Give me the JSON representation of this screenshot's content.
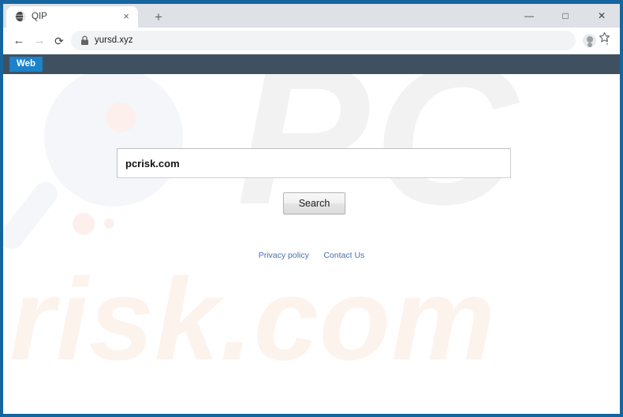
{
  "browser": {
    "tab": {
      "title": "QIP",
      "favicon_icon": "globe-icon",
      "close_icon": "×"
    },
    "new_tab_icon": "+",
    "window_controls": {
      "minimize": "—",
      "maximize": "□",
      "close": "✕"
    },
    "toolbar": {
      "back_icon": "←",
      "forward_icon": "→",
      "reload_icon": "⟳",
      "lock_icon": "lock-icon",
      "url": "yursd.xyz",
      "star_icon": "star-icon",
      "avatar_icon": "profile-avatar-icon",
      "menu_icon": "⋮"
    }
  },
  "site": {
    "nav": {
      "web_tab_label": "Web"
    },
    "search": {
      "value": "pcrisk.com",
      "placeholder": "",
      "button_label": "Search"
    },
    "footer": {
      "links": [
        {
          "label": "Privacy policy"
        },
        {
          "label": "Contact Us"
        }
      ]
    },
    "watermarks": {
      "top_text": "PC",
      "bottom_text": "risk.com",
      "magnifier_icon": "magnifying-glass-watermark"
    }
  },
  "colors": {
    "window_frame": "#15659f",
    "tabstrip": "#dee1e6",
    "site_bar": "#3f5161",
    "web_tab": "#1b82cb",
    "link": "#4a6fad",
    "watermark_gray": "#f2f2f2",
    "watermark_peach": "#fdf3ed"
  }
}
